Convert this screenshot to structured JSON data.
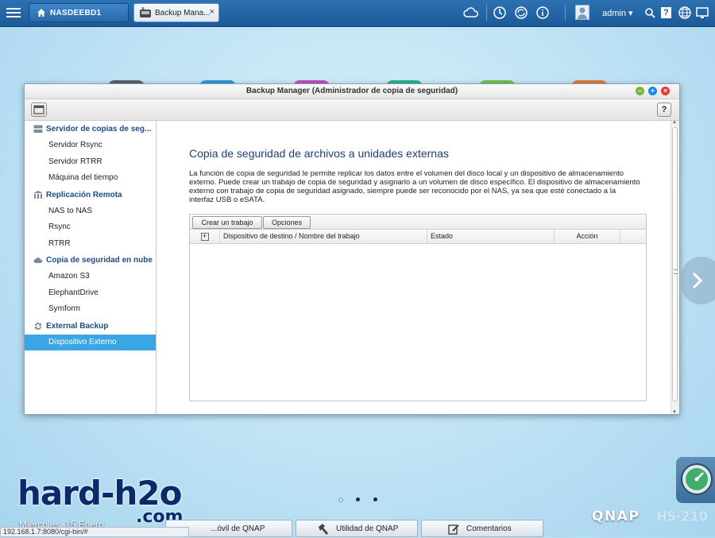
{
  "topbar": {
    "home_tab": "NASDEEBD1",
    "app_tab": "Backup Mana...",
    "user": "admin",
    "user_caret": "▾",
    "close_char": "×",
    "help_char": "?"
  },
  "window": {
    "title": "Backup Manager (Administrador de copia de seguridad)",
    "help": "?",
    "controls": {
      "minimize": "–",
      "maximize": "+",
      "close": "×"
    }
  },
  "sidebar": {
    "groups": [
      {
        "label": "Servidor de copias de seg...",
        "icon": "server-icon",
        "items": [
          "Servidor Rsync",
          "Servidor RTRR",
          "Máquina del tiempo"
        ]
      },
      {
        "label": "Replicación Remota",
        "icon": "building-icon",
        "items": [
          "NAS to NAS",
          "Rsync",
          "RTRR"
        ]
      },
      {
        "label": "Copia de seguridad en nube",
        "icon": "cloud-icon",
        "items": [
          "Amazon S3",
          "ElephantDrive",
          "Symform"
        ]
      },
      {
        "label": "External Backup",
        "icon": "sync-arrows-icon",
        "items": [
          "Dispositivo Externo"
        ]
      }
    ],
    "active_item": "Dispositivo Externo"
  },
  "content": {
    "title": "Copia de seguridad de archivos a unidades externas",
    "description": "La función de copia de seguridad le permite replicar los datos entre el volumen del disco local y un dispositivo de almacenamiento externo. Puede crear un trabajo de copia de seguridad y asignarlo a un volumen de disco específico. El dispositivo de almacenamiento externo con trabajo de copia de seguridad asignado, siempre puede ser reconocido por el NAS, ya sea que esté conectado a la interfaz USB o eSATA.",
    "buttons": {
      "create": "Crear un trabajo",
      "options": "Opciones"
    },
    "columns": [
      "Dispositivo de destino / Nombre del trabajo",
      "Estado",
      "Acción"
    ],
    "expand_char": "+"
  },
  "desktop": {
    "watermark": "hard-h2o",
    "watermark_sub": ".com",
    "date": "Miércoles, 15 Enero",
    "dock": [
      "...óvil de QNAP",
      "Utilidad de QNAP",
      "Comentarios"
    ],
    "brand": "QNAP",
    "model": "HS-210",
    "status_url": "192.168.1.7:8080/cgi-bin/#"
  },
  "colors": {
    "accent": "#3aa6e6",
    "topbar": "#1c5a99",
    "title_text": "#1d3f73",
    "watermark": "#0a2a6c"
  }
}
